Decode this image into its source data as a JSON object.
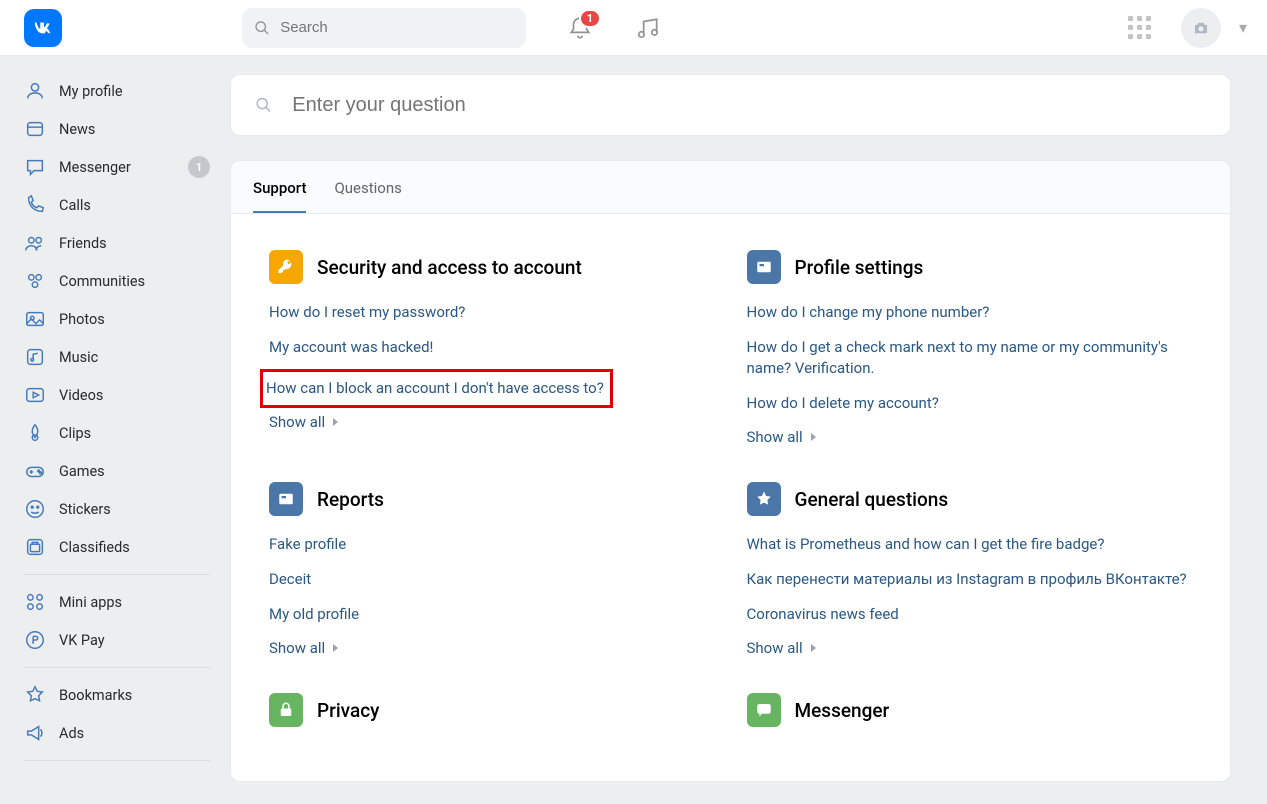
{
  "header": {
    "search_placeholder": "Search",
    "notif_badge": "1"
  },
  "sidebar": {
    "items": [
      {
        "id": "my-profile",
        "label": "My profile"
      },
      {
        "id": "news",
        "label": "News"
      },
      {
        "id": "messenger",
        "label": "Messenger",
        "count": "1"
      },
      {
        "id": "calls",
        "label": "Calls"
      },
      {
        "id": "friends",
        "label": "Friends"
      },
      {
        "id": "communities",
        "label": "Communities"
      },
      {
        "id": "photos",
        "label": "Photos"
      },
      {
        "id": "music",
        "label": "Music"
      },
      {
        "id": "videos",
        "label": "Videos"
      },
      {
        "id": "clips",
        "label": "Clips"
      },
      {
        "id": "games",
        "label": "Games"
      },
      {
        "id": "stickers",
        "label": "Stickers"
      },
      {
        "id": "classifieds",
        "label": "Classifieds"
      }
    ],
    "items2": [
      {
        "id": "mini-apps",
        "label": "Mini apps"
      },
      {
        "id": "vk-pay",
        "label": "VK Pay"
      }
    ],
    "items3": [
      {
        "id": "bookmarks",
        "label": "Bookmarks"
      },
      {
        "id": "ads",
        "label": "Ads"
      }
    ]
  },
  "main": {
    "question_placeholder": "Enter your question",
    "tabs": [
      {
        "label": "Support",
        "active": true
      },
      {
        "label": "Questions",
        "active": false
      }
    ],
    "showall_label": "Show all",
    "sections": [
      {
        "id": "security",
        "title": "Security and access to account",
        "icon_color": "#f7a700",
        "icon": "key",
        "links": [
          {
            "text": "How do I reset my password?"
          },
          {
            "text": "My account was hacked!"
          },
          {
            "text": "How can I block an account I don't have access to?",
            "highlight": true
          }
        ]
      },
      {
        "id": "profile-settings",
        "title": "Profile settings",
        "icon_color": "#4a76a8",
        "icon": "card",
        "links": [
          {
            "text": "How do I change my phone number?"
          },
          {
            "text": "How do I get a check mark next to my name or my community's name? Verification."
          },
          {
            "text": "How do I delete my account?"
          }
        ]
      },
      {
        "id": "reports",
        "title": "Reports",
        "icon_color": "#4a76a8",
        "icon": "card",
        "links": [
          {
            "text": "Fake profile"
          },
          {
            "text": "Deceit"
          },
          {
            "text": "My old profile"
          }
        ]
      },
      {
        "id": "general",
        "title": "General questions",
        "icon_color": "#4a76a8",
        "icon": "star",
        "links": [
          {
            "text": "What is Prometheus and how can I get the fire badge?"
          },
          {
            "text": "Как перенести материалы из Instagram в профиль ВКонтакте?"
          },
          {
            "text": "Coronavirus news feed"
          }
        ]
      },
      {
        "id": "privacy",
        "title": "Privacy",
        "icon_color": "#67b561",
        "icon": "lock",
        "links": []
      },
      {
        "id": "messenger-sec",
        "title": "Messenger",
        "icon_color": "#67b561",
        "icon": "chat",
        "links": []
      }
    ]
  }
}
